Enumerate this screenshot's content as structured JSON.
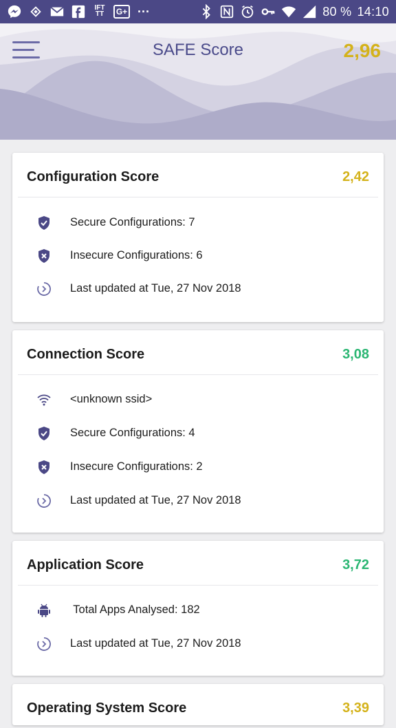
{
  "statusbar": {
    "battery_text": "80 %",
    "time": "14:10",
    "left_icons": [
      "messenger-icon",
      "sync-icon",
      "gmail-icon",
      "facebook-icon",
      "ifttt-icon",
      "google-plus-icon",
      "more-notifications-icon"
    ],
    "right_icons": [
      "bluetooth-icon",
      "nfc-icon",
      "alarm-icon",
      "key-icon",
      "wifi-icon",
      "signal-icon",
      "battery-icon"
    ],
    "ifttt_label": "IFT TT",
    "gplus_label": "G+",
    "more_label": "···"
  },
  "header": {
    "title": "SAFE Score",
    "overall_score": "2,96",
    "overall_score_color": "#d4b21a"
  },
  "cards": [
    {
      "title": "Configuration Score",
      "score": "2,42",
      "score_color": "#d4b21a",
      "rows": [
        {
          "icon": "shield-check-icon",
          "text": "Secure Configurations: 7"
        },
        {
          "icon": "shield-x-icon",
          "text": "Insecure Configurations: 6"
        },
        {
          "icon": "clock-refresh-icon",
          "text": "Last updated at Tue, 27 Nov 2018"
        }
      ]
    },
    {
      "title": "Connection Score",
      "score": "3,08",
      "score_color": "#2bb673",
      "rows": [
        {
          "icon": "wifi-icon",
          "text": "<unknown ssid>"
        },
        {
          "icon": "shield-check-icon",
          "text": "Secure Configurations: 4"
        },
        {
          "icon": "shield-x-icon",
          "text": "Insecure Configurations: 2"
        },
        {
          "icon": "clock-refresh-icon",
          "text": "Last updated at Tue, 27 Nov 2018"
        }
      ]
    },
    {
      "title": "Application Score",
      "score": "3,72",
      "score_color": "#2bb673",
      "rows": [
        {
          "icon": "android-icon",
          "text": " Total Apps Analysed: 182"
        },
        {
          "icon": "clock-refresh-icon",
          "text": "Last updated at Tue, 27 Nov 2018"
        }
      ]
    },
    {
      "title": "Operating System Score",
      "score": "3,39",
      "score_color": "#d4b21a",
      "rows": []
    }
  ]
}
